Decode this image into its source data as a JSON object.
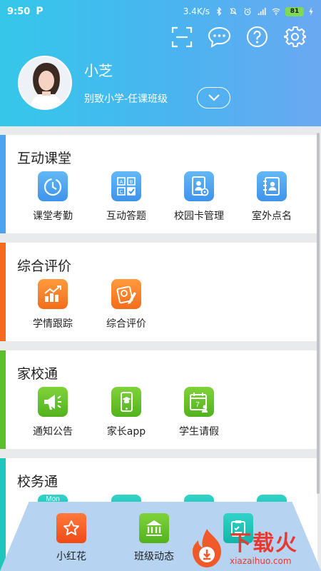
{
  "status": {
    "time": "9:50",
    "app_badge": "P",
    "net_speed": "3.4K/s",
    "battery": "81"
  },
  "user": {
    "name": "小芝",
    "school_class": "别致小学-任课班级"
  },
  "sections": [
    {
      "title": "互动课堂",
      "accent": "#4aa4f2",
      "items": [
        {
          "label": "课堂考勤",
          "icon": "clock-icon"
        },
        {
          "label": "互动答题",
          "icon": "quiz-icon"
        },
        {
          "label": "校园卡管理",
          "icon": "campus-card-icon"
        },
        {
          "label": "室外点名",
          "icon": "roll-call-icon"
        }
      ]
    },
    {
      "title": "综合评价",
      "accent": "#f56a1f",
      "items": [
        {
          "label": "学情跟踪",
          "icon": "trend-chart-icon"
        },
        {
          "label": "综合评价",
          "icon": "evaluation-icon"
        }
      ]
    },
    {
      "title": "家校通",
      "accent": "#5cc02c",
      "items": [
        {
          "label": "通知公告",
          "icon": "megaphone-icon"
        },
        {
          "label": "家长app",
          "icon": "phone-icon"
        },
        {
          "label": "学生请假",
          "icon": "calendar-leave-icon"
        }
      ]
    },
    {
      "title": "校务通",
      "accent": "#20c6bd",
      "items": [
        {
          "label": "Mon",
          "icon": "calendar-icon"
        }
      ]
    }
  ],
  "bottom_bar": {
    "items": [
      {
        "label": "小红花",
        "icon": "star-icon"
      },
      {
        "label": "班级动态",
        "icon": "building-icon"
      },
      {
        "label": "",
        "icon": "checklist-icon"
      }
    ]
  },
  "watermark": {
    "main": "下载火",
    "sub": "xiazaihuo.com"
  }
}
